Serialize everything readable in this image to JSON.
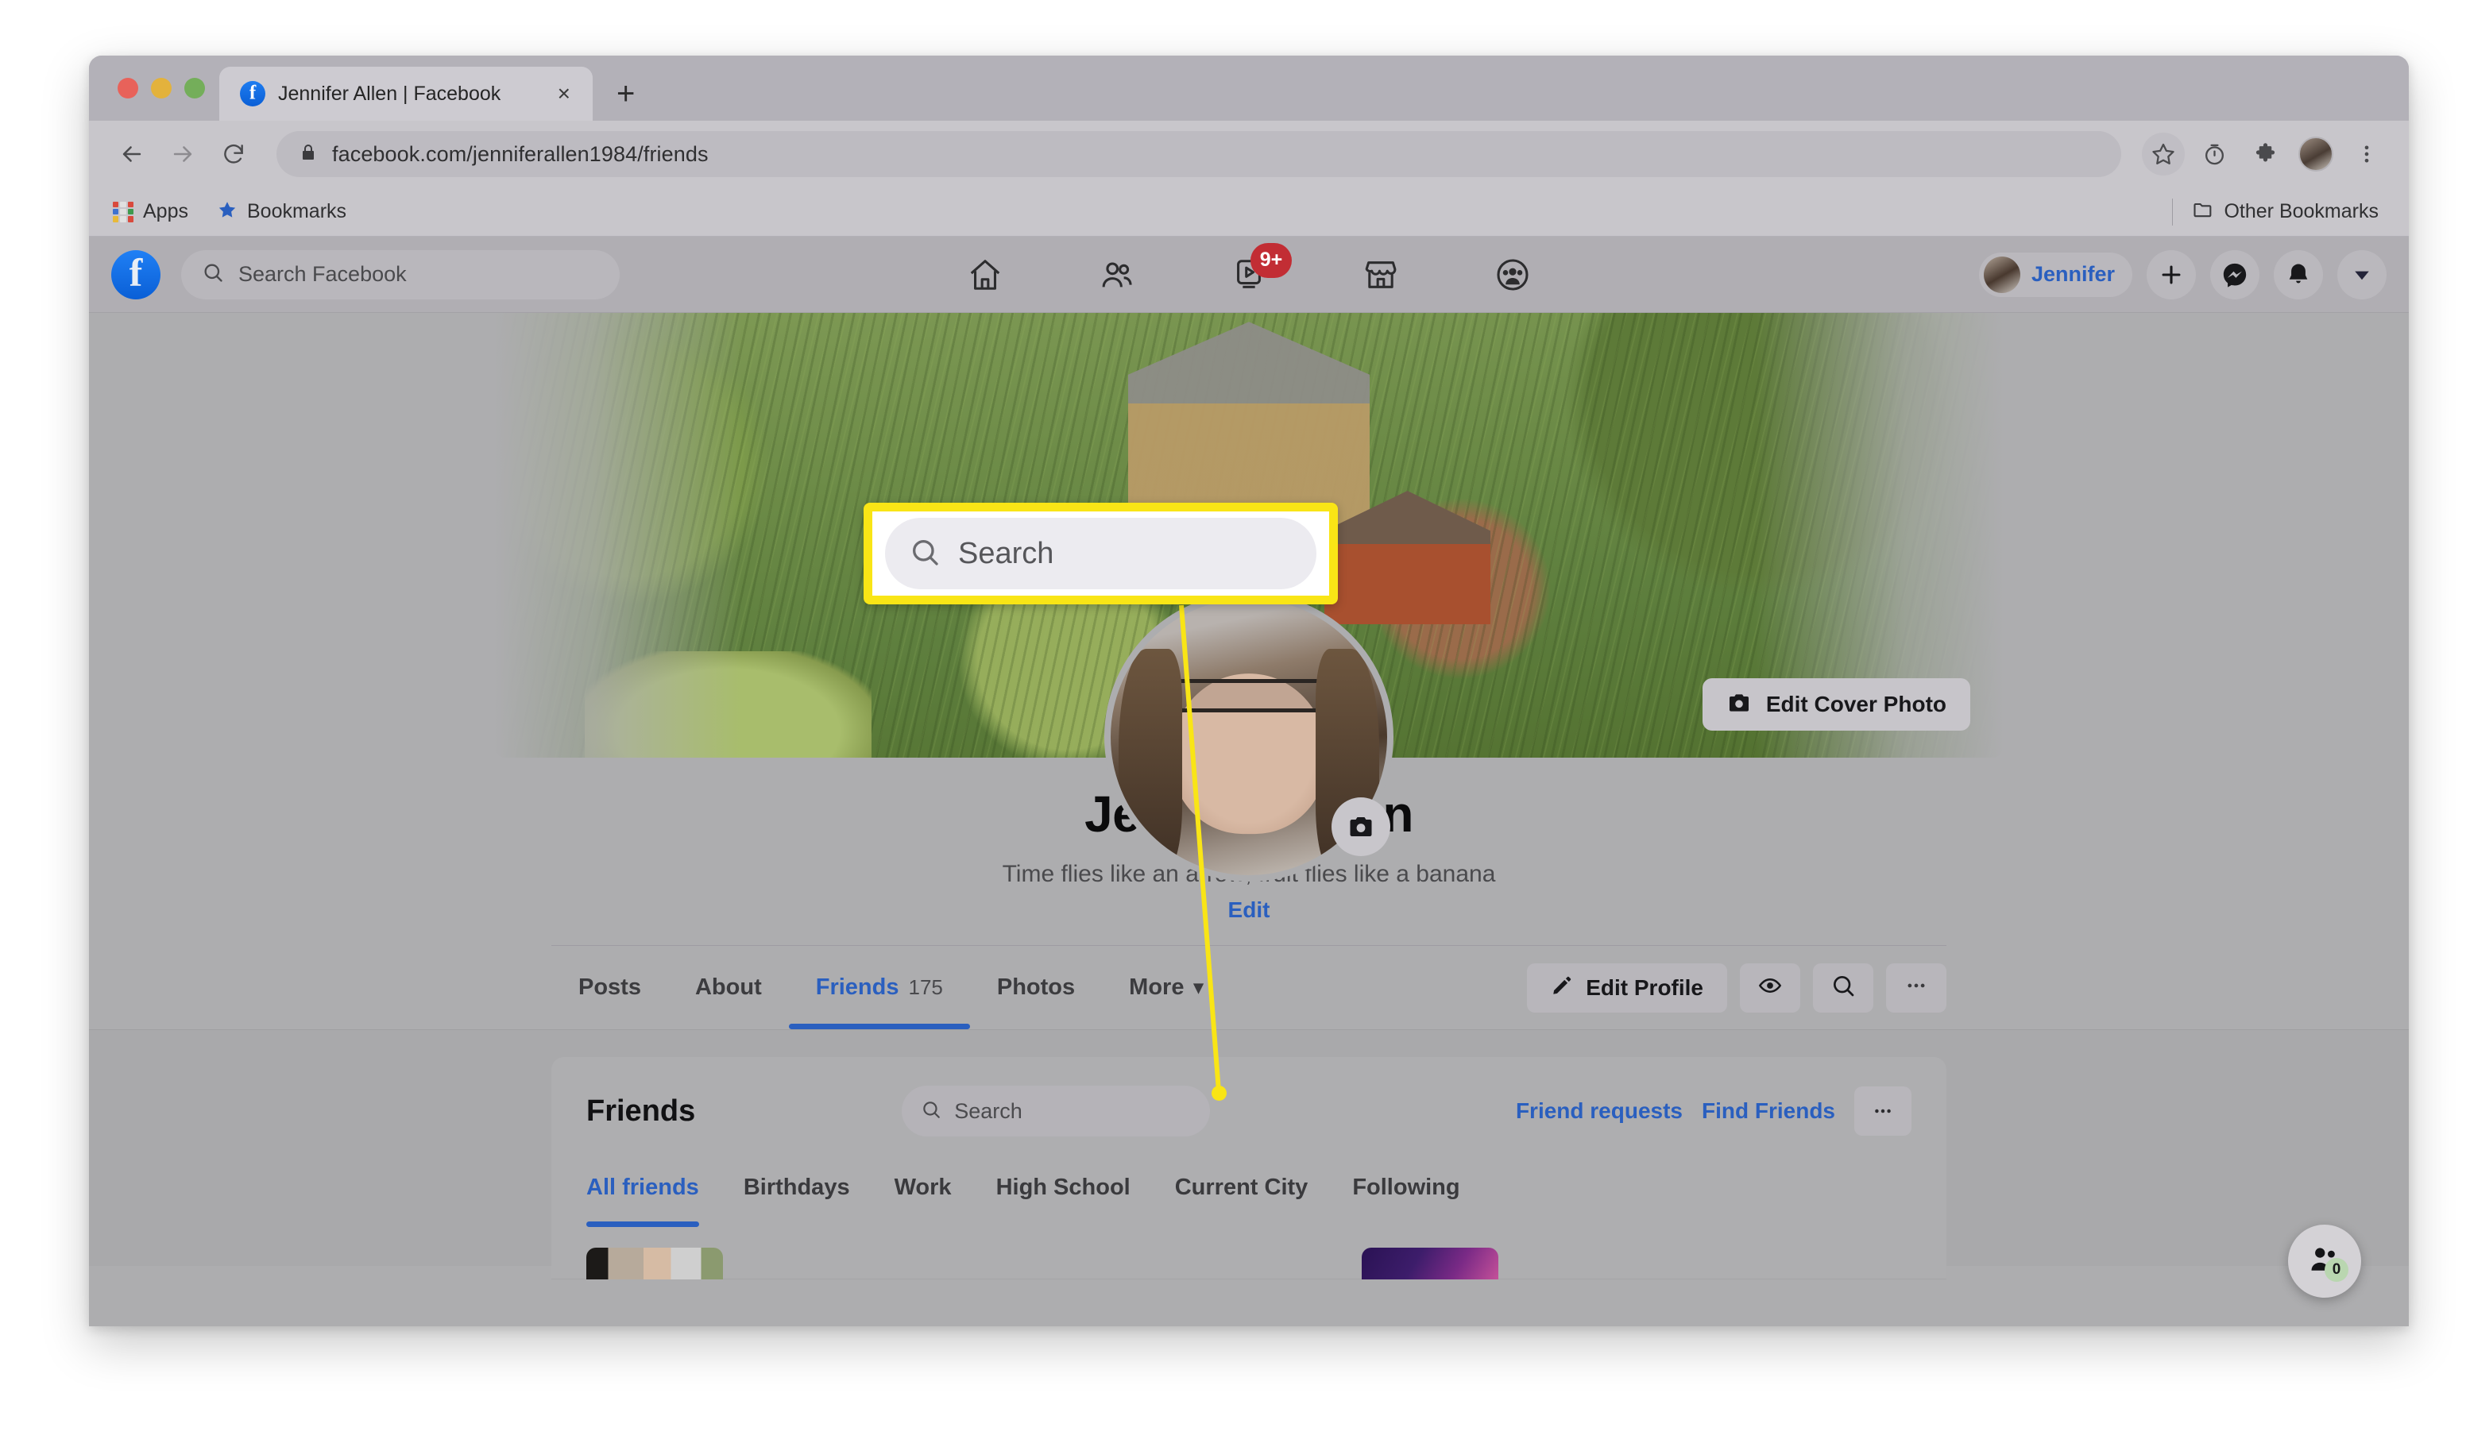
{
  "browser": {
    "tab": {
      "title": "Jennifer Allen | Facebook",
      "favicon": "facebook-favicon",
      "close": "×"
    },
    "new_tab": "+",
    "omnibox": {
      "url": "facebook.com/jenniferallen1984/friends",
      "lock_icon": "lock-icon"
    },
    "nav": {
      "back": "back-arrow-icon",
      "forward": "forward-arrow-icon",
      "reload": "reload-icon"
    },
    "toolbar_right": {
      "bookmark_star": "star-icon",
      "history": "history-clock-icon",
      "extensions": "puzzle-piece-icon",
      "account": "account-avatar-icon",
      "menu": "three-dot-menu-icon"
    },
    "bookmarks": {
      "apps_label": "Apps",
      "bookmarks_label": "Bookmarks",
      "other_bookmarks_label": "Other Bookmarks"
    }
  },
  "facebook": {
    "nav": {
      "logo": "facebook-logo",
      "search_placeholder": "Search Facebook",
      "center_items": [
        {
          "name": "home",
          "icon": "home-icon",
          "badge": ""
        },
        {
          "name": "friends",
          "icon": "friends-icon",
          "badge": ""
        },
        {
          "name": "watch",
          "icon": "watch-play-icon",
          "badge": "9+"
        },
        {
          "name": "marketplace",
          "icon": "marketplace-shop-icon",
          "badge": ""
        },
        {
          "name": "groups",
          "icon": "groups-icon",
          "badge": ""
        }
      ],
      "user_name": "Jennifer",
      "create_icon": "plus-icon",
      "messenger_icon": "messenger-icon",
      "notifications_icon": "bell-icon",
      "account_menu_icon": "chevron-down-icon"
    },
    "cover": {
      "edit_label": "Edit Cover Photo",
      "edit_icon": "camera-icon",
      "profile_photo_camera_icon": "camera-icon"
    },
    "profile": {
      "name": "Jennifer Allen",
      "bio": "Time flies like an arrow; fruit flies like a banana",
      "bio_edit": "Edit"
    },
    "profile_tabs": [
      {
        "label": "Posts",
        "count": "",
        "active": false
      },
      {
        "label": "About",
        "count": "",
        "active": false
      },
      {
        "label": "Friends",
        "count": "175",
        "active": true
      },
      {
        "label": "Photos",
        "count": "",
        "active": false
      },
      {
        "label": "More",
        "count": "",
        "active": false,
        "caret": "▾"
      }
    ],
    "profile_actions": {
      "edit_profile_label": "Edit Profile",
      "edit_profile_icon": "pencil-icon",
      "view_as_icon": "eye-icon",
      "search_icon": "search-icon",
      "more_icon": "three-dots-icon"
    },
    "friends_card": {
      "title": "Friends",
      "search_placeholder": "Search",
      "friend_requests_label": "Friend requests",
      "find_friends_label": "Find Friends",
      "more_icon": "three-dots-icon",
      "subtabs": [
        {
          "label": "All friends",
          "active": true
        },
        {
          "label": "Birthdays",
          "active": false
        },
        {
          "label": "Work",
          "active": false
        },
        {
          "label": "High School",
          "active": false
        },
        {
          "label": "Current City",
          "active": false
        },
        {
          "label": "Following",
          "active": false
        }
      ]
    },
    "chat_fab": {
      "icon": "contacts-icon",
      "badge": "0"
    }
  },
  "annotation": {
    "callout_search_text": "Search",
    "callout_search_icon": "search-icon",
    "highlight_color": "#f9e516"
  }
}
